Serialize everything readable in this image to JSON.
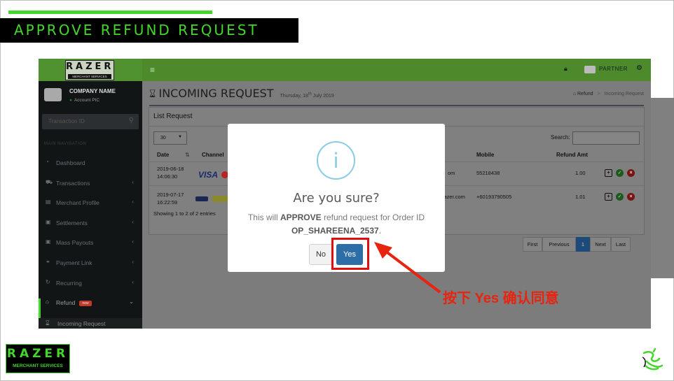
{
  "slide": {
    "title": "APPROVE REFUND REQUEST",
    "brand_word": "RAZER",
    "brand_sub": "MERCHANT SERVICES",
    "annotation": "按下 Yes 确认同意",
    "accent_color": "#44d62c",
    "annotation_color": "#e8230f"
  },
  "topbar": {
    "logo_word": "RAZER",
    "logo_sub": "MERCHANT SERVICES",
    "menu_icon": "hamburger-icon",
    "user_label": "PARTNER"
  },
  "sidebar": {
    "company_name": "COMPANY NAME",
    "account_pic": "Account PIC",
    "search_placeholder": "Transaction ID",
    "nav_header": "MAIN NAVIGATION",
    "items": [
      {
        "label": "Dashboard",
        "icon": "dashboard-icon"
      },
      {
        "label": "Transactions",
        "icon": "cart-icon"
      },
      {
        "label": "Merchant Profile",
        "icon": "profile-icon"
      },
      {
        "label": "Settlements",
        "icon": "settlement-icon"
      },
      {
        "label": "Mass Payouts",
        "icon": "payout-icon"
      },
      {
        "label": "Payment Link",
        "icon": "link-icon"
      },
      {
        "label": "Recurring",
        "icon": "recurring-icon"
      },
      {
        "label": "Refund",
        "icon": "refund-icon",
        "badge": "new"
      }
    ],
    "active_subitem": "Incoming Request"
  },
  "page": {
    "title": "INCOMING REQUEST",
    "date_prefix": "Thursday, 18",
    "date_sup": "th",
    "date_suffix": " July 2019",
    "breadcrumb_parent": "Refund",
    "breadcrumb_current": "Incoming Request"
  },
  "list": {
    "heading": "List Request",
    "page_length": "30",
    "search_label": "Search:",
    "search_value": "",
    "columns": {
      "date": "Date",
      "channel": "Channel",
      "mobile": "Mobile",
      "refund_amt": "Refund Amt"
    },
    "rows": [
      {
        "date": "2019-06-18",
        "time": "14:06:30",
        "email_tail": "om",
        "mobile": "55218438",
        "amount": "1.00"
      },
      {
        "date": "2019-07-17",
        "time": "16:22:59",
        "email_tail": "razer.com",
        "mobile": "+60193790505",
        "amount": "1.01"
      }
    ],
    "showing": "Showing 1 to 2 of 2 entries",
    "pager": {
      "first": "First",
      "previous": "Previous",
      "current": "1",
      "next": "Next",
      "last": "Last"
    }
  },
  "modal": {
    "title": "Are you sure?",
    "text_prefix": "This will ",
    "text_action": "APPROVE",
    "text_middle": " refund request for Order ID",
    "order_id": "OP_SHAREENA_2537",
    "text_end": ".",
    "no_label": "No",
    "yes_label": "Yes"
  }
}
